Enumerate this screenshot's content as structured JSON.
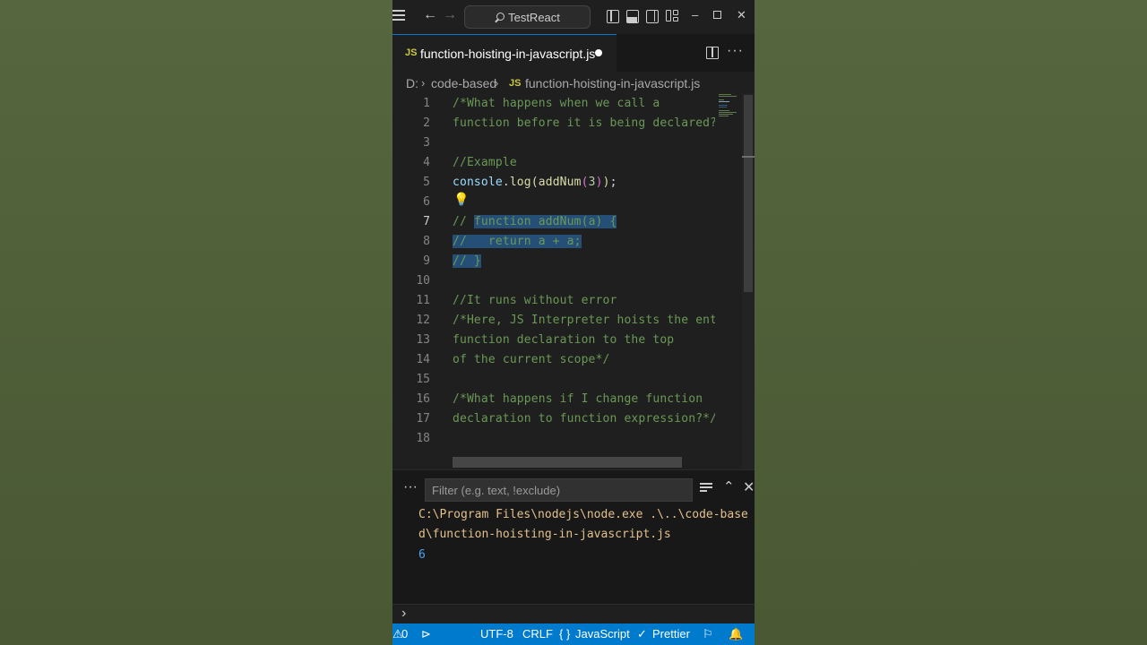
{
  "title_bar": {
    "search_text": "TestReact"
  },
  "tab": {
    "badge": "JS",
    "filename": "function-hoisting-in-javascript.js"
  },
  "breadcrumb": {
    "drive": "D:",
    "folder": "code-based",
    "badge": "JS",
    "file": "function-hoisting-in-javascript.js"
  },
  "editor": {
    "active_line": 7,
    "line_numbers": [
      "1",
      "2",
      "3",
      "4",
      "5",
      "6",
      "7",
      "8",
      "9",
      "10",
      "11",
      "12",
      "13",
      "14",
      "15",
      "16",
      "17",
      "18"
    ],
    "lines": {
      "l1": "/*What happens when we call a",
      "l2": "function before it is being declared?*",
      "l4": "//Example",
      "l5_obj": "console",
      "l5_dot": ".",
      "l5_fn": "log",
      "l5_p1": "(",
      "l5_arg": "addNum",
      "l5_p2": "(",
      "l5_num": "3",
      "l5_p3": ")",
      "l5_p4": ")",
      "l5_semi": ";",
      "l7_prefix": "// ",
      "l7_sel": "function addNum(a) {",
      "l8_sel": "//   return a + a;",
      "l9_sel": "// }",
      "l11": "//It runs without error",
      "l12": "/*Here, JS Interpreter hoists the enti",
      "l13": "function declaration to the top",
      "l14": "of the current scope*/",
      "l16": "/*What happens if I change function",
      "l17": "declaration to function expression?*/"
    }
  },
  "panel": {
    "filter_placeholder": "Filter (e.g. text, !exclude)",
    "output_line1": "C:\\Program Files\\nodejs\\node.exe .\\..\\code-base",
    "output_line2": "d\\function-hoisting-in-javascript.js",
    "output_result": "6"
  },
  "status_bar": {
    "problems": "0",
    "encoding": "UTF-8",
    "eol": "CRLF",
    "language": "JavaScript",
    "formatter": "Prettier"
  },
  "colors": {
    "statusbar": "#007acc",
    "comment": "#6a9955",
    "selection": "#264f78",
    "output_path": "#e2c08d",
    "output_number": "#4fa1ee"
  }
}
